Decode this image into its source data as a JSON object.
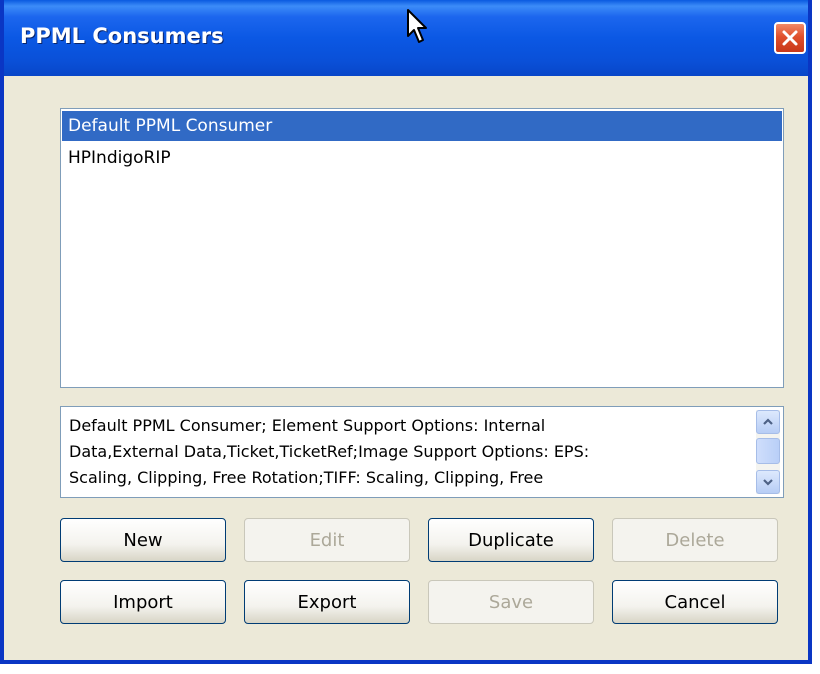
{
  "window": {
    "title": "PPML Consumers",
    "close_icon": "close-x-icon"
  },
  "consumers": {
    "items": [
      {
        "label": "Default PPML Consumer",
        "selected": true
      },
      {
        "label": "HPIndigoRIP",
        "selected": false
      }
    ]
  },
  "description": {
    "text": "Default PPML Consumer; Element Support Options: Internal\nData,External Data,Ticket,TicketRef;Image Support Options: EPS:\nScaling, Clipping, Free Rotation;TIFF: Scaling, Clipping, Free"
  },
  "buttons": {
    "new": {
      "label": "New",
      "enabled": true
    },
    "edit": {
      "label": "Edit",
      "enabled": false
    },
    "duplicate": {
      "label": "Duplicate",
      "enabled": true
    },
    "delete": {
      "label": "Delete",
      "enabled": false
    },
    "import": {
      "label": "Import",
      "enabled": true
    },
    "export": {
      "label": "Export",
      "enabled": true
    },
    "save": {
      "label": "Save",
      "enabled": false
    },
    "cancel": {
      "label": "Cancel",
      "enabled": true
    }
  },
  "colors": {
    "titlebar": "#0a58e4",
    "selection": "#316ac5",
    "dialog_bg": "#ece9d8",
    "disabled_text": "#aca899"
  }
}
